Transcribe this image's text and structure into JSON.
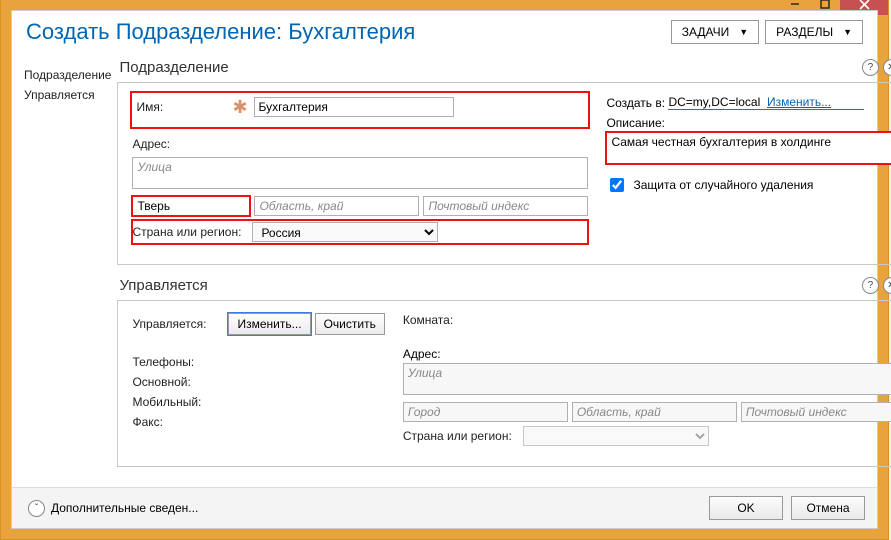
{
  "window": {
    "title": "Создать Подразделение: Бухгалтерия",
    "task_btn": "ЗАДАЧИ",
    "sections_btn": "РАЗДЕЛЫ"
  },
  "leftnav": {
    "items": [
      "Подразделение",
      "Управляется"
    ]
  },
  "section1": {
    "title": "Подразделение",
    "name_label": "Имя:",
    "name_value": "Бухгалтерия",
    "address_label": "Адрес:",
    "street_ph": "Улица",
    "city_value": "Тверь",
    "state_ph": "Область, край",
    "zip_ph": "Почтовый индекс",
    "country_label": "Страна или регион:",
    "country_value": "Россия",
    "create_in_label": "Создать в:",
    "create_in_value": "DC=my,DC=local",
    "change_link": "Изменить...",
    "desc_label": "Описание:",
    "desc_value": "Самая честная бухгалтерия в холдинге",
    "protect_label": "Защита от случайного удаления",
    "protect_checked": true
  },
  "section2": {
    "title": "Управляется",
    "managed_label": "Управляется:",
    "change_btn": "Изменить...",
    "clear_btn": "Очистить",
    "phones_label": "Телефоны:",
    "main_label": "Основной:",
    "mobile_label": "Мобильный:",
    "fax_label": "Факс:",
    "room_label": "Комната:",
    "address_label": "Адрес:",
    "street_ph": "Улица",
    "city_ph": "Город",
    "state_ph": "Область, край",
    "zip_ph": "Почтовый индекс",
    "country_label": "Страна или регион:"
  },
  "footer": {
    "more_label": "Дополнительные сведен...",
    "ok": "OK",
    "cancel": "Отмена"
  }
}
